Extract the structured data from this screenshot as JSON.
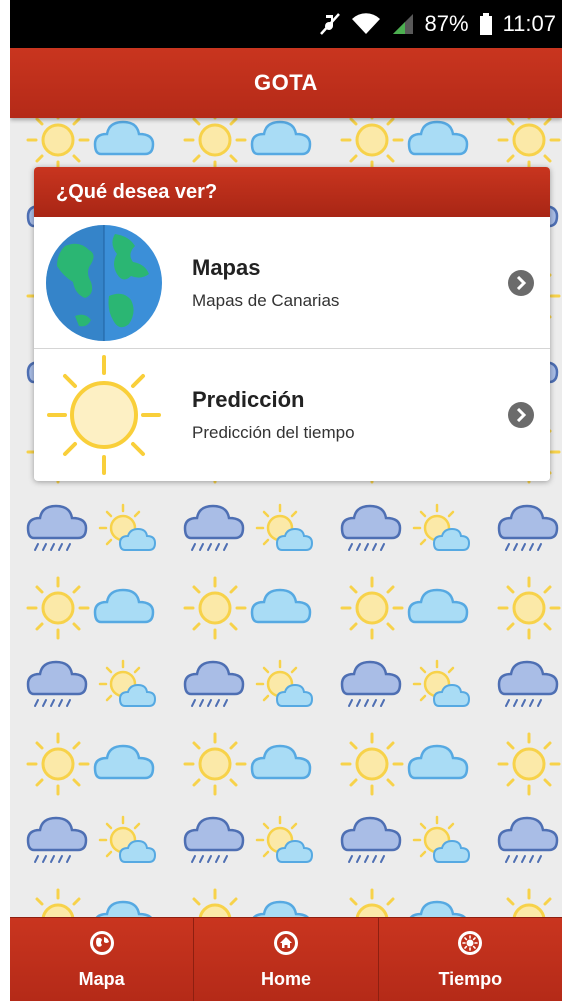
{
  "status_bar": {
    "battery": "87%",
    "time": "11:07",
    "icons": [
      "mute-icon",
      "wifi-icon",
      "signal-icon",
      "battery-icon"
    ]
  },
  "header": {
    "title": "GOTA"
  },
  "dialog": {
    "title": "¿Qué desea ver?",
    "options": [
      {
        "name": "Mapas",
        "description": "Mapas de Canarias",
        "icon": "globe-icon"
      },
      {
        "name": "Predicción",
        "description": "Predicción del tiempo",
        "icon": "sun-icon"
      }
    ]
  },
  "footer": {
    "tabs": [
      {
        "label": "Mapa",
        "icon": "globe-icon"
      },
      {
        "label": "Home",
        "icon": "home-icon"
      },
      {
        "label": "Tiempo",
        "icon": "sun-icon"
      }
    ]
  },
  "colors": {
    "accent": "#c0311c",
    "accent_dark": "#8e1f10"
  }
}
